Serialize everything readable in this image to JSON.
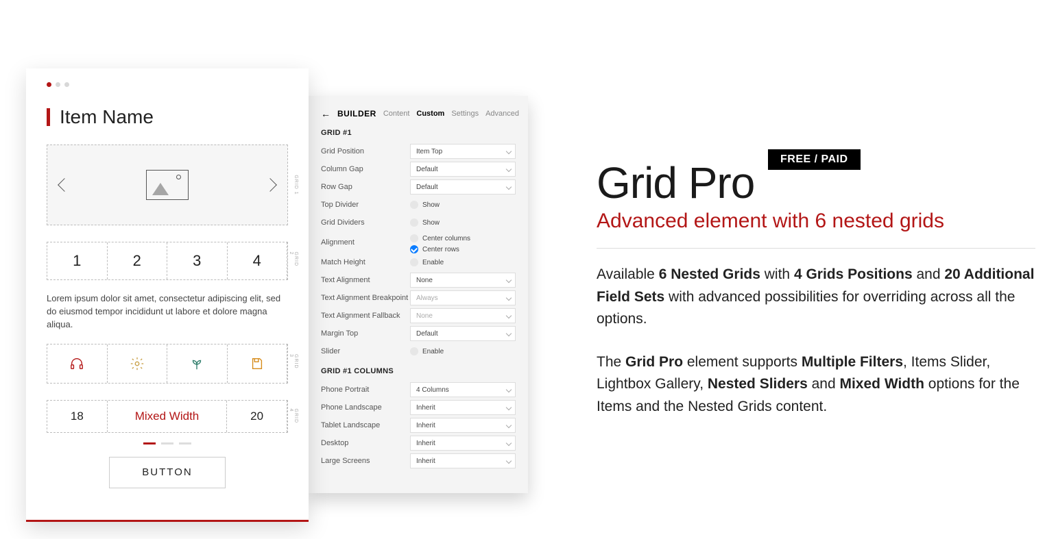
{
  "badge": "FREE / PAID",
  "product": {
    "name": "Grid Pro",
    "subtitle": "Advanced element with 6 nested grids",
    "para1_parts": [
      "Available ",
      "6 Nested Grids",
      " with ",
      "4 Grids Positions",
      " and ",
      "20 Additional Field Sets",
      " with advanced possibilities for overriding across all the options."
    ],
    "para2_parts": [
      "The ",
      "Grid Pro",
      " element supports ",
      "Multiple Filters",
      ", Items Slider, Lightbox Gallery, ",
      "Nested Sliders",
      " and ",
      "Mixed Width",
      " options for the Items and the Nested Grids content."
    ]
  },
  "card": {
    "title": "Item Name",
    "lorem": "Lorem ipsum dolor sit amet, consectetur adipiscing elit, sed do eiusmod tempor incididunt ut labore et dolore magna aliqua.",
    "grid1_label": "GRID 1",
    "grid2_label": "GRID 2",
    "grid2_cells": [
      "1",
      "2",
      "3",
      "4"
    ],
    "grid3_label": "GRID 3",
    "grid4_label": "GRID 4",
    "grid4_cells": [
      "18",
      "Mixed Width",
      "20"
    ],
    "button": "BUTTON"
  },
  "panel": {
    "header": {
      "title": "BUILDER",
      "tabs": [
        "Content",
        "Custom",
        "Settings",
        "Advanced"
      ],
      "active": "Custom"
    },
    "section1": "GRID #1",
    "rows1": [
      {
        "label": "Grid Position",
        "type": "select",
        "value": "Item Top"
      },
      {
        "label": "Column Gap",
        "type": "select",
        "value": "Default"
      },
      {
        "label": "Row Gap",
        "type": "select",
        "value": "Default"
      },
      {
        "label": "Top Divider",
        "type": "toggle",
        "value": "Show",
        "checked": false
      },
      {
        "label": "Grid Dividers",
        "type": "toggle",
        "value": "Show",
        "checked": false
      },
      {
        "label": "Alignment",
        "type": "toggles",
        "options": [
          {
            "value": "Center columns",
            "checked": false
          },
          {
            "value": "Center rows",
            "checked": true
          }
        ]
      },
      {
        "label": "Match Height",
        "type": "toggle",
        "value": "Enable",
        "checked": false
      },
      {
        "label": "Text Alignment",
        "type": "select",
        "value": "None"
      },
      {
        "label": "Text Alignment Breakpoint",
        "type": "select",
        "value": "Always",
        "dim": true
      },
      {
        "label": "Text Alignment Fallback",
        "type": "select",
        "value": "None",
        "dim": true
      },
      {
        "label": "Margin Top",
        "type": "select",
        "value": "Default"
      },
      {
        "label": "Slider",
        "type": "toggle",
        "value": "Enable",
        "checked": false
      }
    ],
    "section2": "GRID #1  COLUMNS",
    "rows2": [
      {
        "label": "Phone Portrait",
        "type": "select",
        "value": "4 Columns"
      },
      {
        "label": "Phone Landscape",
        "type": "select",
        "value": "Inherit"
      },
      {
        "label": "Tablet Landscape",
        "type": "select",
        "value": "Inherit"
      },
      {
        "label": "Desktop",
        "type": "select",
        "value": "Inherit"
      },
      {
        "label": "Large Screens",
        "type": "select",
        "value": "Inherit"
      }
    ]
  }
}
